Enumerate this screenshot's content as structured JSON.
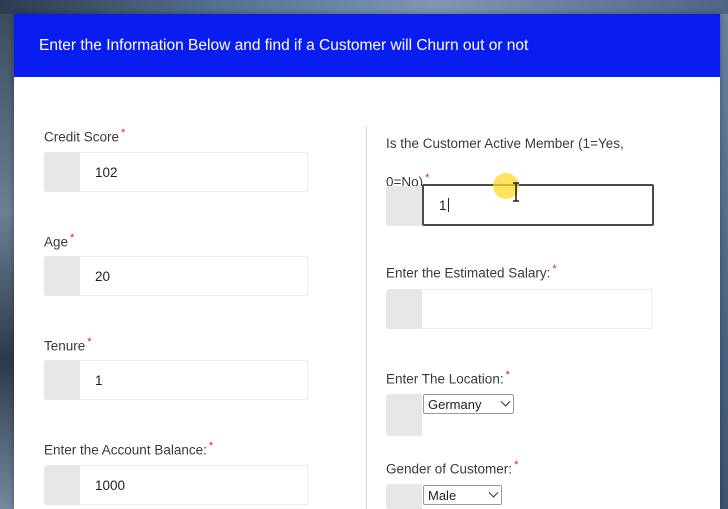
{
  "header": {
    "title": "Enter the Information Below and find if a Customer will Churn out or not"
  },
  "form": {
    "credit_score": {
      "label": "Credit Score",
      "required_mark": "*",
      "value": "102"
    },
    "age": {
      "label": "Age",
      "required_mark": "*",
      "value": "20"
    },
    "tenure": {
      "label": "Tenure",
      "required_mark": "*",
      "value": "1"
    },
    "account_balance": {
      "label": "Enter the Account Balance:",
      "required_mark": "*",
      "value": "1000"
    },
    "active_member": {
      "label_line1": "Is the Customer Active Member (1=Yes,",
      "label_line2": "0=No)",
      "required_mark": "*",
      "value": "1"
    },
    "estimated_salary": {
      "label": "Enter the Estimated Salary:",
      "required_mark": "*",
      "value": ""
    },
    "location": {
      "label": "Enter The Location:",
      "required_mark": "*",
      "selected": "Germany"
    },
    "gender": {
      "label": "Gender of Customer:",
      "required_mark": "*",
      "selected": "Male"
    }
  }
}
